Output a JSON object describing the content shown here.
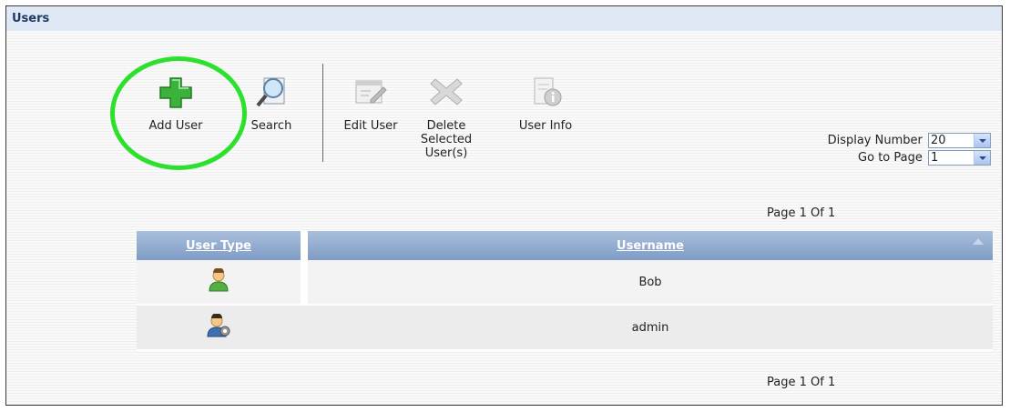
{
  "panel": {
    "title": "Users"
  },
  "toolbar": {
    "add_user": {
      "label": "Add User",
      "icon": "plus-icon"
    },
    "search": {
      "label": "Search",
      "icon": "magnifier-icon"
    },
    "edit_user": {
      "label": "Edit User",
      "icon": "edit-icon"
    },
    "delete_selected": {
      "label_line1": "Delete",
      "label_line2": "Selected",
      "label_line3": "User(s)",
      "icon": "delete-x-icon"
    },
    "user_info": {
      "label": "User Info",
      "icon": "info-doc-icon"
    }
  },
  "display": {
    "display_number_label": "Display Number",
    "display_number_value": "20",
    "go_to_page_label": "Go to Page",
    "go_to_page_value": "1"
  },
  "pagination": {
    "top": "Page 1 Of 1",
    "bottom": "Page 1 Of 1"
  },
  "table": {
    "headers": {
      "user_type": "User Type",
      "username": "Username"
    },
    "rows": [
      {
        "user_type_icon": "user-icon",
        "username": "Bob"
      },
      {
        "user_type_icon": "admin-user-icon",
        "username": "admin"
      }
    ]
  },
  "colors": {
    "highlight": "#2ee02e",
    "header": "#8fa8cf",
    "titlebar": "#dfe9f5"
  }
}
